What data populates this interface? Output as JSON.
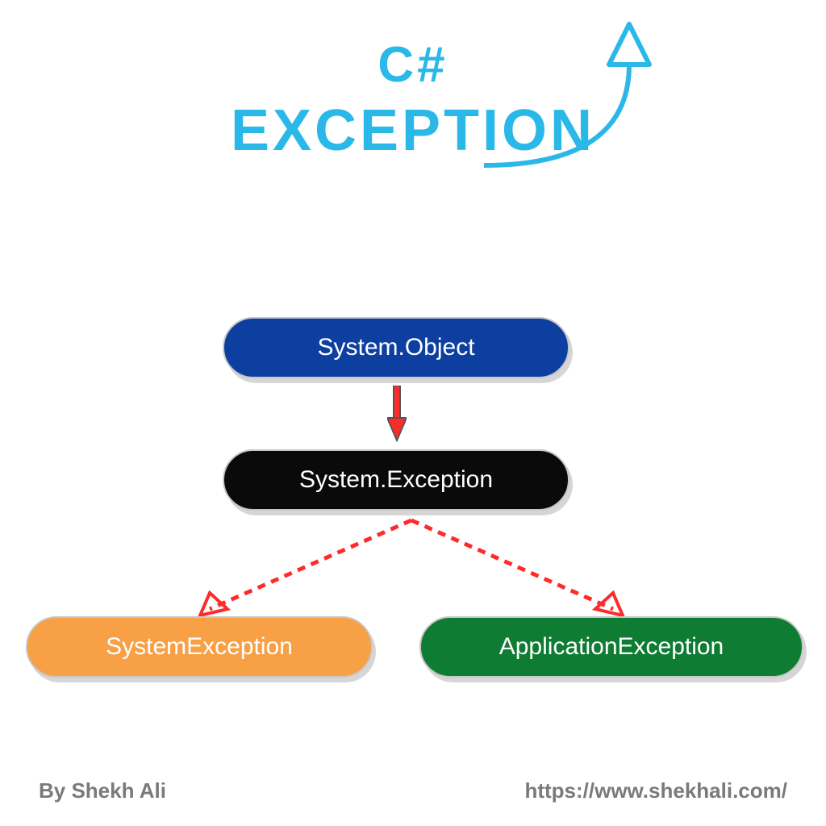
{
  "title": {
    "line1": "C#",
    "line2": "EXCEPTION"
  },
  "nodes": {
    "object": "System.Object",
    "exception": "System.Exception",
    "systemException": "SystemException",
    "applicationException": "ApplicationException"
  },
  "footer": {
    "author": "By Shekh Ali",
    "url": "https://www.shekhali.com/"
  },
  "colors": {
    "titleColor": "#2ab8e8",
    "objectBg": "#0d3fa0",
    "exceptionBg": "#0a0a0a",
    "systemExcBg": "#f7a045",
    "appExcBg": "#0e7c33",
    "arrowSolidStroke": "#555555",
    "arrowSolidFill": "#ff2a2a",
    "arrowDashed": "#ff2a2a",
    "curvedArrow": "#2ab8e8"
  }
}
